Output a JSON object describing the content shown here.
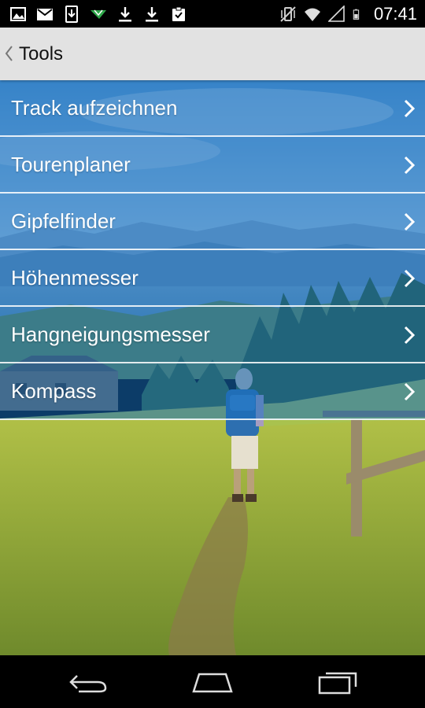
{
  "status_bar": {
    "time": "07:41",
    "left_icons": [
      "image-notification-icon",
      "gmail-icon",
      "download-box-icon",
      "hike-app-icon",
      "download-icon",
      "download-icon",
      "clipboard-check-icon"
    ],
    "right_icons": [
      "vibrate-icon",
      "wifi-icon",
      "signal-icon",
      "battery-icon"
    ]
  },
  "action_bar": {
    "title": "Tools",
    "back_icon": "chevron-left-icon"
  },
  "menu": {
    "items": [
      {
        "label": "Track aufzeichnen"
      },
      {
        "label": "Tourenplaner"
      },
      {
        "label": "Gipfelfinder"
      },
      {
        "label": "Höhenmesser"
      },
      {
        "label": "Hangneigungsmesser"
      },
      {
        "label": "Kompass"
      }
    ],
    "chevron_icon": "chevron-right-icon"
  },
  "nav_bar": {
    "icons": [
      "back-icon",
      "home-icon",
      "recent-apps-icon"
    ]
  },
  "colors": {
    "list_overlay": "#166ebe",
    "action_bar": "#e2e2e2",
    "status_bar": "#000000"
  }
}
